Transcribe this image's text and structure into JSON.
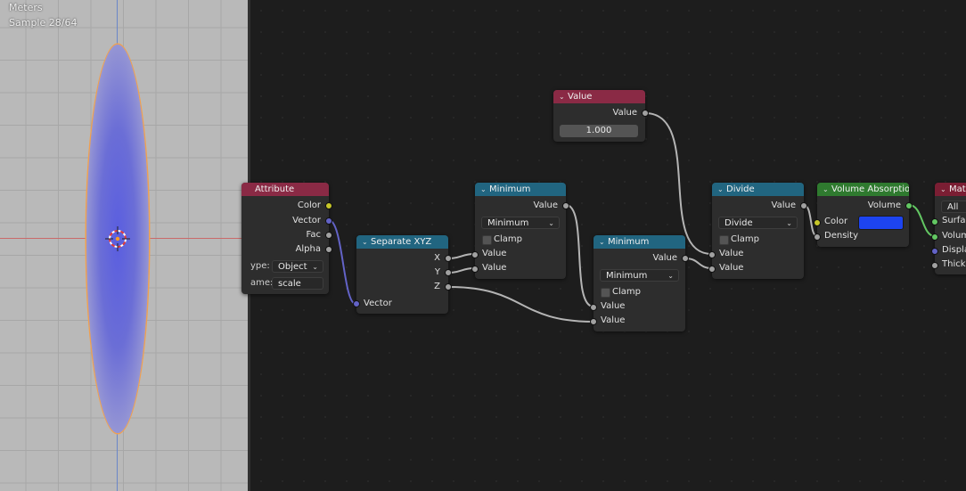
{
  "viewport": {
    "unit_label": "Meters",
    "sample_label": "Sample 28/64"
  },
  "nodes": {
    "value": {
      "title": "Value",
      "output": "Value",
      "field": "1.000"
    },
    "attribute": {
      "title": "Attribute",
      "outputs": [
        "Color",
        "Vector",
        "Fac",
        "Alpha"
      ],
      "type_label": "ype:",
      "type_value": "Object",
      "name_label": "ame:",
      "name_value": "scale"
    },
    "separate_xyz": {
      "title": "Separate XYZ",
      "outputs": [
        "X",
        "Y",
        "Z"
      ],
      "input": "Vector"
    },
    "minimum1": {
      "title": "Minimum",
      "output": "Value",
      "operation": "Minimum",
      "clamp": "Clamp",
      "inputs": [
        "Value",
        "Value"
      ]
    },
    "minimum2": {
      "title": "Minimum",
      "output": "Value",
      "operation": "Minimum",
      "clamp": "Clamp",
      "inputs": [
        "Value",
        "Value"
      ]
    },
    "divide": {
      "title": "Divide",
      "output": "Value",
      "operation": "Divide",
      "clamp": "Clamp",
      "inputs": [
        "Value",
        "Value"
      ]
    },
    "volume_absorption": {
      "title": "Volume Absorption",
      "output": "Volume",
      "inputs": [
        "Color",
        "Density"
      ],
      "color": "#1d44f0"
    },
    "material_output": {
      "title": "Mat",
      "target": "All",
      "inputs": [
        "Surface",
        "Volume",
        "Displac",
        "Thickn"
      ]
    }
  },
  "colors": {
    "header_input": "#8a2a45",
    "header_converter": "#216580",
    "header_shader": "#2f7a2f",
    "header_output": "#7a1e33",
    "wire": "#b4b4b4",
    "wire_vector": "#6363c7",
    "wire_shader": "#63c763"
  }
}
